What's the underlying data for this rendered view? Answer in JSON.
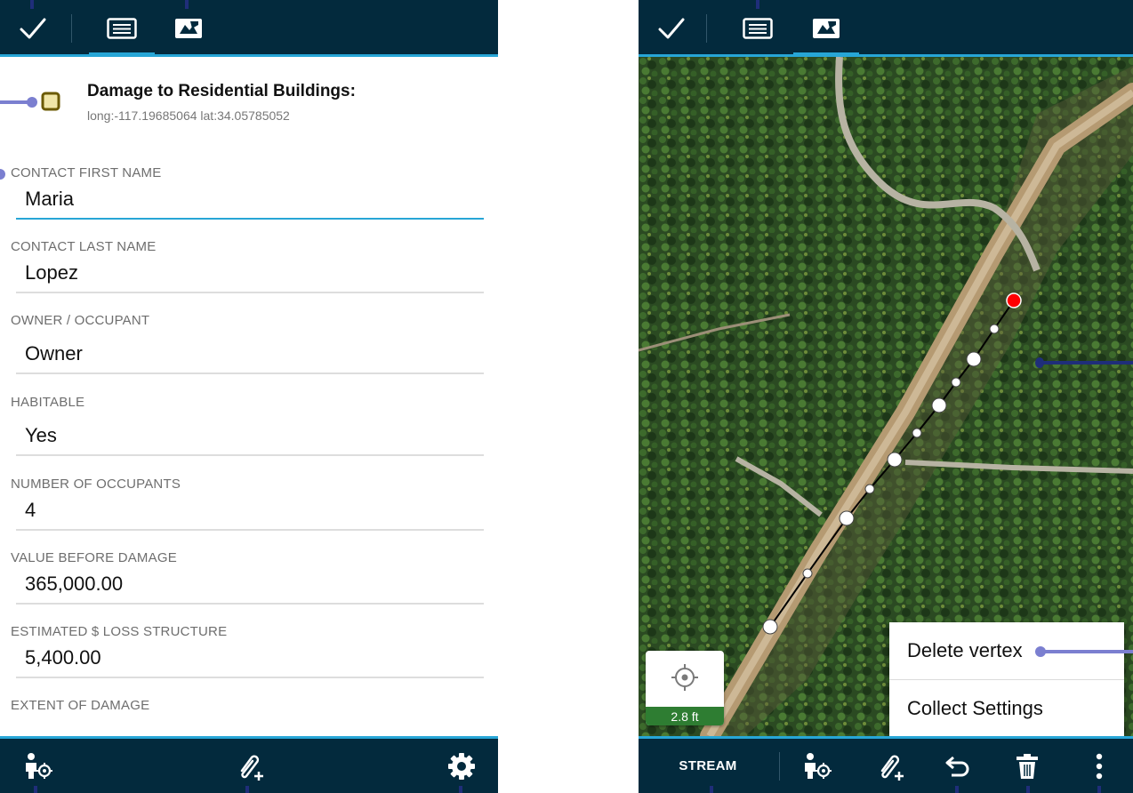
{
  "colors": {
    "bar_bg": "#032a3d",
    "accent": "#27a6d6",
    "callout": "#7b7fd0",
    "vertex_selected": "#ff0000",
    "accuracy_badge": "#2e7d32"
  },
  "form_screen": {
    "toolbar": {
      "icons": [
        "check-icon",
        "form-icon",
        "map-edit-icon"
      ],
      "active_tab": "form-icon"
    },
    "feature": {
      "icon": "point-feature-icon",
      "title": "Damage to Residential Buildings:",
      "coords": "long:-117.19685064 lat:34.05785052"
    },
    "fields": [
      {
        "label": "CONTACT FIRST NAME",
        "value": "Maria",
        "focused": true
      },
      {
        "label": "CONTACT LAST NAME",
        "value": "Lopez",
        "focused": false
      },
      {
        "label": "OWNER / OCCUPANT",
        "value": "Owner",
        "focused": false
      },
      {
        "label": "HABITABLE",
        "value": "Yes",
        "focused": false
      },
      {
        "label": "NUMBER OF OCCUPANTS",
        "value": "4",
        "focused": false
      },
      {
        "label": "VALUE BEFORE DAMAGE",
        "value": "365,000.00",
        "focused": false
      },
      {
        "label": "ESTIMATED $ LOSS STRUCTURE",
        "value": "5,400.00",
        "focused": false
      },
      {
        "label": "EXTENT OF DAMAGE",
        "value": "",
        "focused": false
      }
    ],
    "bottombar": {
      "icons": [
        "gps-person-icon",
        "attachment-add-icon",
        "gear-icon"
      ]
    }
  },
  "map_screen": {
    "toolbar": {
      "icons": [
        "check-icon",
        "form-icon",
        "map-edit-icon"
      ],
      "active_tab": "map-edit-icon"
    },
    "location": {
      "icon": "crosshair-icon",
      "accuracy": "2.8 ft"
    },
    "context_menu": {
      "items": [
        "Delete vertex",
        "Collect Settings"
      ]
    },
    "bottombar": {
      "stream_label": "STREAM",
      "icons": [
        "gps-person-icon",
        "attachment-add-icon",
        "undo-icon",
        "trash-icon",
        "more-vert-icon"
      ]
    }
  }
}
